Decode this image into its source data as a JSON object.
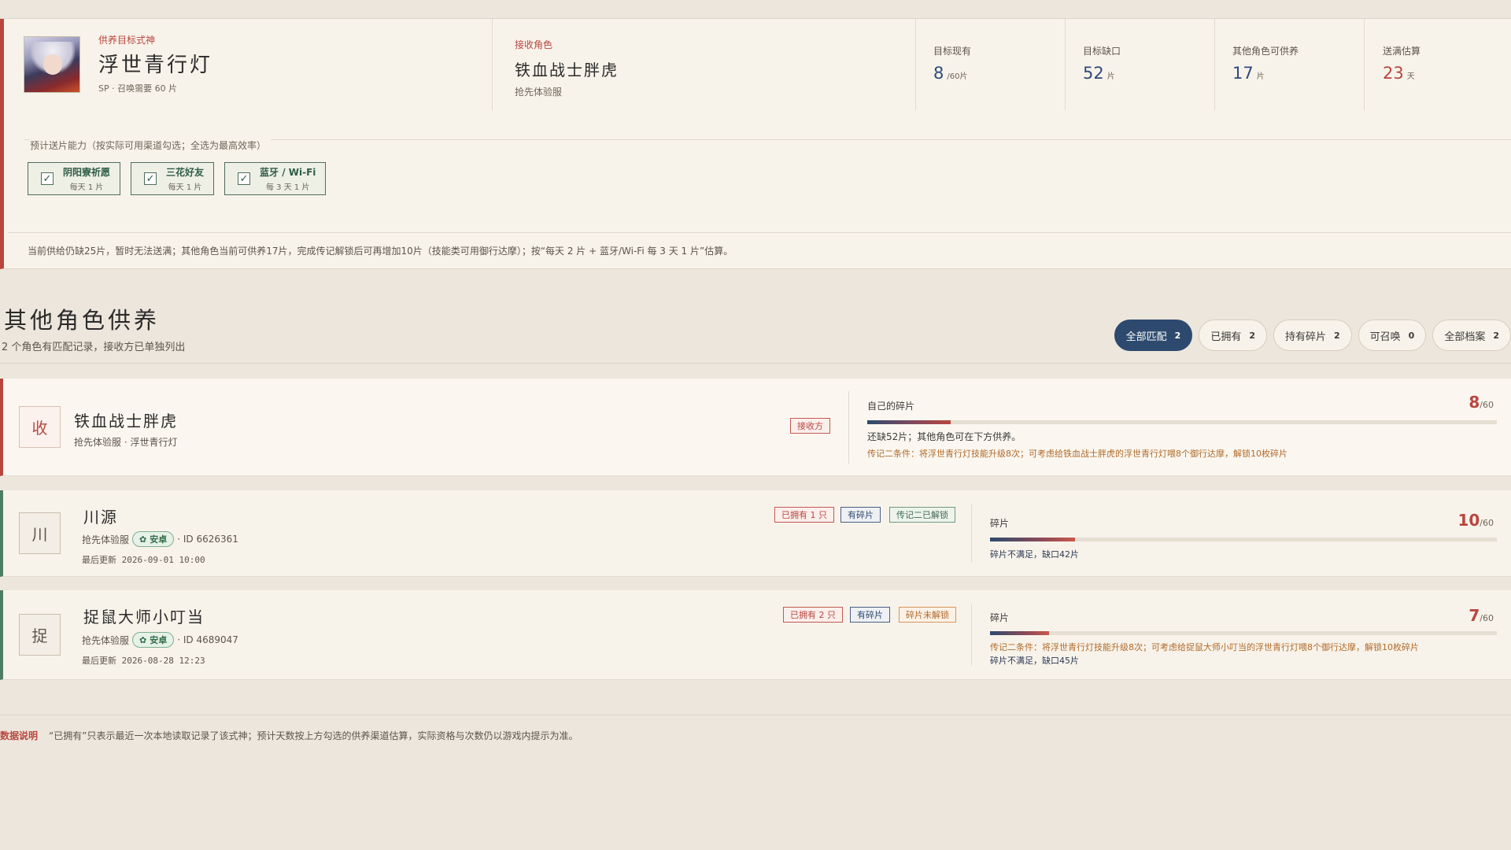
{
  "target": {
    "kicker": "供养目标式神",
    "name": "浮世青行灯",
    "sub": "SP · 召唤需要 60 片"
  },
  "receiver": {
    "kicker": "接收角色",
    "name": "铁血战士胖虎",
    "server": "抢先体验服"
  },
  "stats": [
    {
      "label": "目标现有",
      "value": "8",
      "unit": "/60片"
    },
    {
      "label": "目标缺口",
      "value": "52",
      "unit": "片"
    },
    {
      "label": "其他角色可供养",
      "value": "17",
      "unit": "片"
    },
    {
      "label": "送满估算",
      "value": "23",
      "unit": "天"
    }
  ],
  "ability": {
    "title": "预计送片能力（按实际可用渠道勾选；全选为最高效率）",
    "channels": [
      {
        "name": "阴阳寮祈愿",
        "rate": "每天 1 片",
        "checked": true
      },
      {
        "name": "三花好友",
        "rate": "每天 1 片",
        "checked": true
      },
      {
        "name": "蓝牙 / Wi-Fi",
        "rate": "每 3 天 1 片",
        "checked": true
      }
    ]
  },
  "supply_note": "当前供给仍缺25片，暂时无法送满；其他角色当前可供养17片，完成传记解锁后可再增加10片（技能类可用御行达摩）；按“每天 2 片 + 蓝牙/Wi-Fi 每 3 天 1 片”估算。",
  "section": {
    "title": "其他角色供养",
    "subtitle": "2 个角色有匹配记录，接收方已单独列出"
  },
  "filters": [
    {
      "label": "全部匹配",
      "count": "2",
      "active": true
    },
    {
      "label": "已拥有",
      "count": "2"
    },
    {
      "label": "持有碎片",
      "count": "2"
    },
    {
      "label": "可召唤",
      "count": "0"
    },
    {
      "label": "全部档案",
      "count": "2"
    }
  ],
  "receiver_card": {
    "glyph": "收",
    "name": "铁血战士胖虎",
    "meta": "抢先体验服 · 浮世青行灯",
    "badge": "接收方",
    "frag_label": "自己的碎片",
    "frag_value": "8",
    "frag_total": "/60",
    "frag_ratio": 0.133,
    "note": "还缺52片；其他角色可在下方供养。",
    "warn": "传记二条件：将浮世青行灯技能升级8次；可考虑给铁血战士胖虎的浮世青行灯喂8个御行达摩，解锁10枚碎片"
  },
  "cards": [
    {
      "glyph": "川",
      "name": "川源",
      "server": "抢先体验服",
      "platform": "安卓",
      "id": "· ID 6626361",
      "updated": "最后更新 2026-09-01 10:00",
      "badges": [
        "已拥有 1 只",
        "有碎片",
        "传记二已解锁"
      ],
      "frag_label": "碎片",
      "frag_value": "10",
      "frag_total": "/60",
      "frag_ratio": 0.167,
      "status": "碎片不满足，缺口42片"
    },
    {
      "glyph": "捉",
      "name": "捉鼠大师小叮当",
      "server": "抢先体验服",
      "platform": "安卓",
      "id": "· ID 4689047",
      "updated": "最后更新 2026-08-28 12:23",
      "badges": [
        "已拥有 2 只",
        "有碎片",
        "碎片未解锁"
      ],
      "frag_label": "碎片",
      "frag_value": "7",
      "frag_total": "/60",
      "frag_ratio": 0.117,
      "warn": "传记二条件：将浮世青行灯技能升级8次；可考虑给捉鼠大师小叮当的浮世青行灯喂8个御行达摩，解锁10枚碎片",
      "status": "碎片不满足，缺口45片"
    }
  ],
  "footer": {
    "tag": "数据说明",
    "text": "“已拥有”只表示最近一次本地读取记录了该式神；预计天数按上方勾选的供养渠道估算，实际资格与次数仍以游戏内提示为准。"
  },
  "colors": {
    "accent_red": "#b8463f",
    "accent_navy": "#2d4a6e",
    "accent_green": "#4f7d64",
    "background": "#ece6dc",
    "card": "#f8f3ea"
  }
}
